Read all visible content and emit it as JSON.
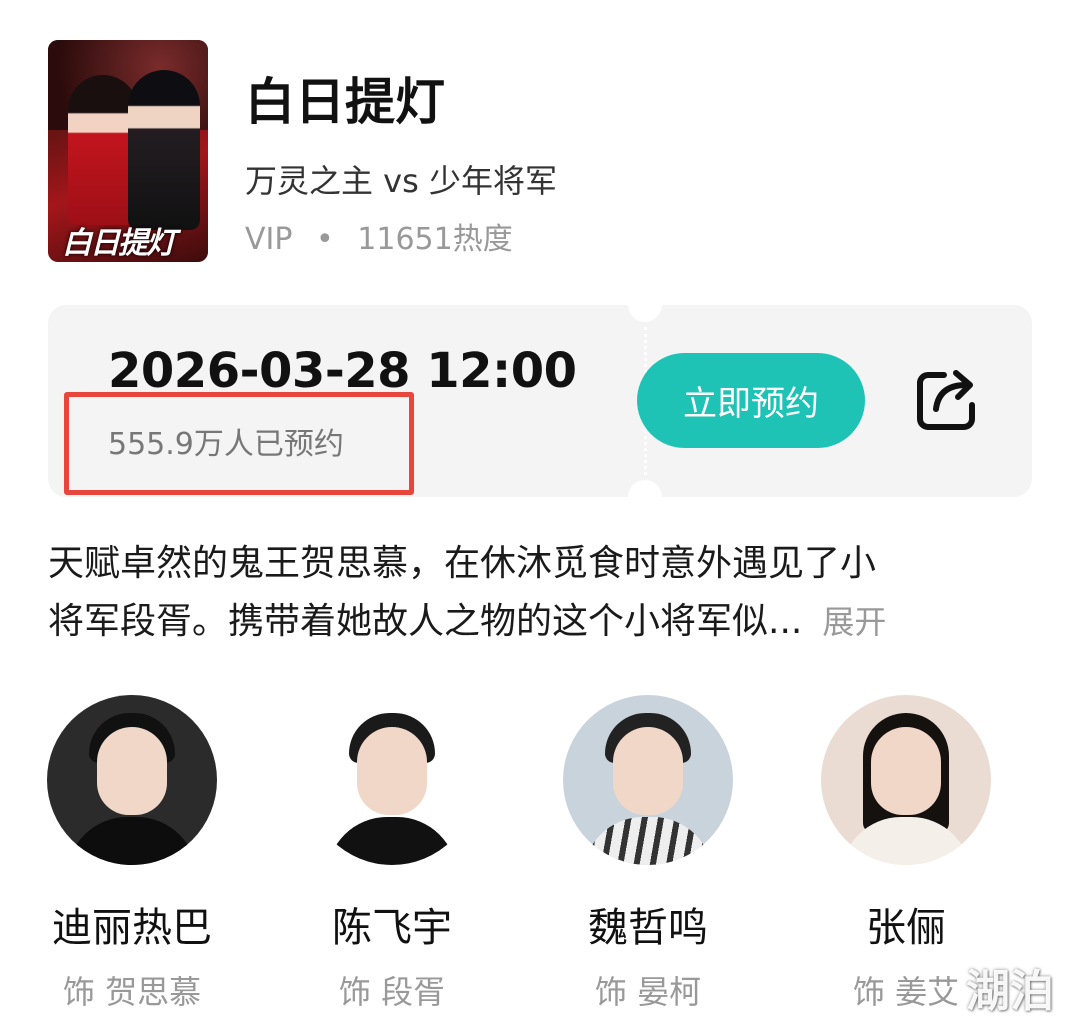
{
  "show": {
    "title": "白日提灯",
    "subtitle": "万灵之主 vs 少年将军",
    "tier": "VIP",
    "separator": "•",
    "heat": "11651热度",
    "poster_text": "白日提灯"
  },
  "ticket": {
    "datetime": "2026-03-28 12:00",
    "reservations": "555.9万人已预约",
    "reserve_label": "立即预约"
  },
  "description": {
    "line1": "天赋卓然的鬼王贺思慕，在休沐觅食时意外遇见了小",
    "line2": "将军段胥。携带着她故人之物的这个小将军似...",
    "expand_label": "展开"
  },
  "cast": [
    {
      "name": "迪丽热巴",
      "role": "饰 贺思慕"
    },
    {
      "name": "陈飞宇",
      "role": "饰 段胥"
    },
    {
      "name": "魏哲鸣",
      "role": "饰 晏柯"
    },
    {
      "name": "张俪",
      "role": "饰 姜艾"
    }
  ],
  "watermark": "湖泊",
  "colors": {
    "accent": "#1fc3b6",
    "highlight_box": "#e8453c",
    "card_bg": "#f4f4f4"
  },
  "icons": {
    "share": "share-icon"
  }
}
